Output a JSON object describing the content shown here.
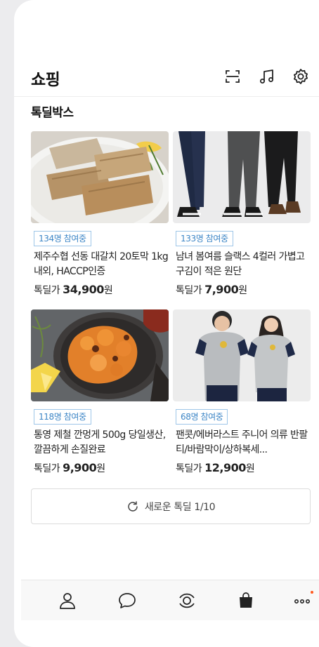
{
  "header": {
    "title": "쇼핑"
  },
  "section": {
    "title": "톡딜박스"
  },
  "products": [
    {
      "participants": "134명 참여중",
      "name": "제주수협 선동 대갈치 20토막 1kg내외, HACCP인증",
      "price_prefix": "톡딜가 ",
      "price": "34,900",
      "price_unit": "원"
    },
    {
      "participants": "133명 참여중",
      "name": "남녀 봄여름 슬랙스 4컬러 가볍고 구김이 적은 원단",
      "price_prefix": "톡딜가 ",
      "price": "7,900",
      "price_unit": "원"
    },
    {
      "participants": "118명 참여중",
      "name": "통영 제철 깐멍게 500g 당일생산, 깔끔하게 손질완료",
      "price_prefix": "톡딜가 ",
      "price": "9,900",
      "price_unit": "원"
    },
    {
      "participants": "68명 참여중",
      "name": "팬콧/에버라스트 주니어 의류 반팔티/바람막이/상하복세...",
      "price_prefix": "톡딜가 ",
      "price": "12,900",
      "price_unit": "원"
    }
  ],
  "refresh": {
    "label": "새로운 톡딜 1/10"
  },
  "colors": {
    "badge_text": "#3d86c6",
    "badge_border": "#9ec6e8",
    "notification_dot": "#ff5a1f"
  }
}
